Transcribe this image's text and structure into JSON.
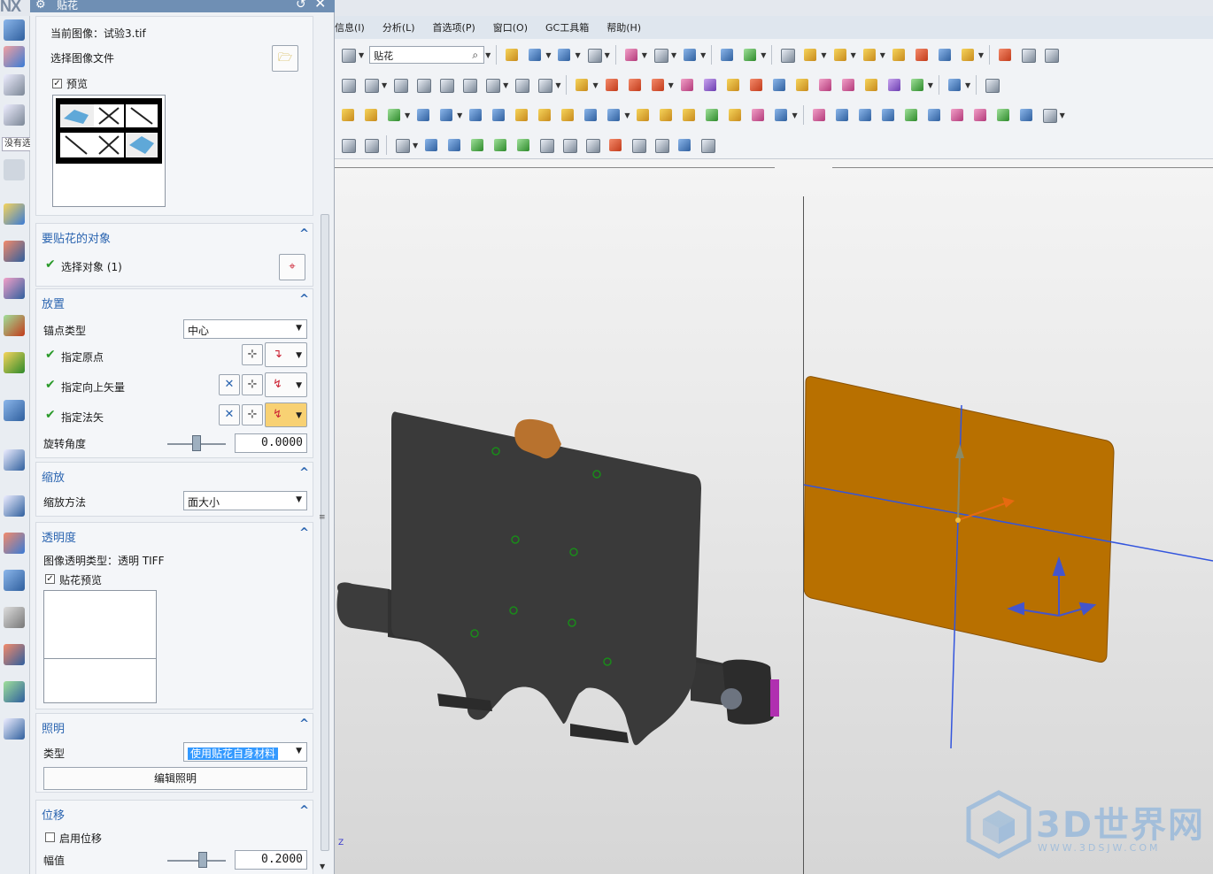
{
  "app": {
    "logo": "NX",
    "resource_label": "没有选"
  },
  "menu": [
    "信息(I)",
    "分析(L)",
    "首选项(P)",
    "窗口(O)",
    "GC工具箱",
    "帮助(H)"
  ],
  "toolbar": {
    "search_value": "贴花"
  },
  "dialog": {
    "title": "贴花",
    "image": {
      "current_label": "当前图像：试验3.tif",
      "choose_label": "选择图像文件",
      "preview_label": "预览",
      "preview_checked": true
    },
    "target": {
      "title": "要贴花的对象",
      "select_label": "选择对象 (1)"
    },
    "placement": {
      "title": "放置",
      "anchor_label": "锚点类型",
      "anchor_value": "中心",
      "origin_label": "指定原点",
      "up_vector_label": "指定向上矢量",
      "normal_label": "指定法矢",
      "rotation_label": "旋转角度",
      "rotation_value": "0.0000",
      "rotation_slider": 0.5
    },
    "scale": {
      "title": "缩放",
      "method_label": "缩放方法",
      "method_value": "面大小"
    },
    "transparency": {
      "title": "透明度",
      "type_label": "图像透明类型：透明 TIFF",
      "preview_label": "贴花预览",
      "preview_checked": true
    },
    "lighting": {
      "title": "照明",
      "type_label": "类型",
      "type_value": "使用贴花自身材料",
      "edit_button": "编辑照明"
    },
    "displacement": {
      "title": "位移",
      "enable_label": "启用位移",
      "enable_checked": false,
      "amplitude_label": "幅值",
      "amplitude_value": "0.2000",
      "amplitude_slider": 0.6
    }
  },
  "viewport": {
    "triad_label": "Z",
    "watermark_main": "3D世界网",
    "watermark_sub": "WWW.3DSJW.COM",
    "colors": {
      "plate": "#b87000",
      "device": "#3a3a3a",
      "axis": "#3355dd"
    }
  }
}
